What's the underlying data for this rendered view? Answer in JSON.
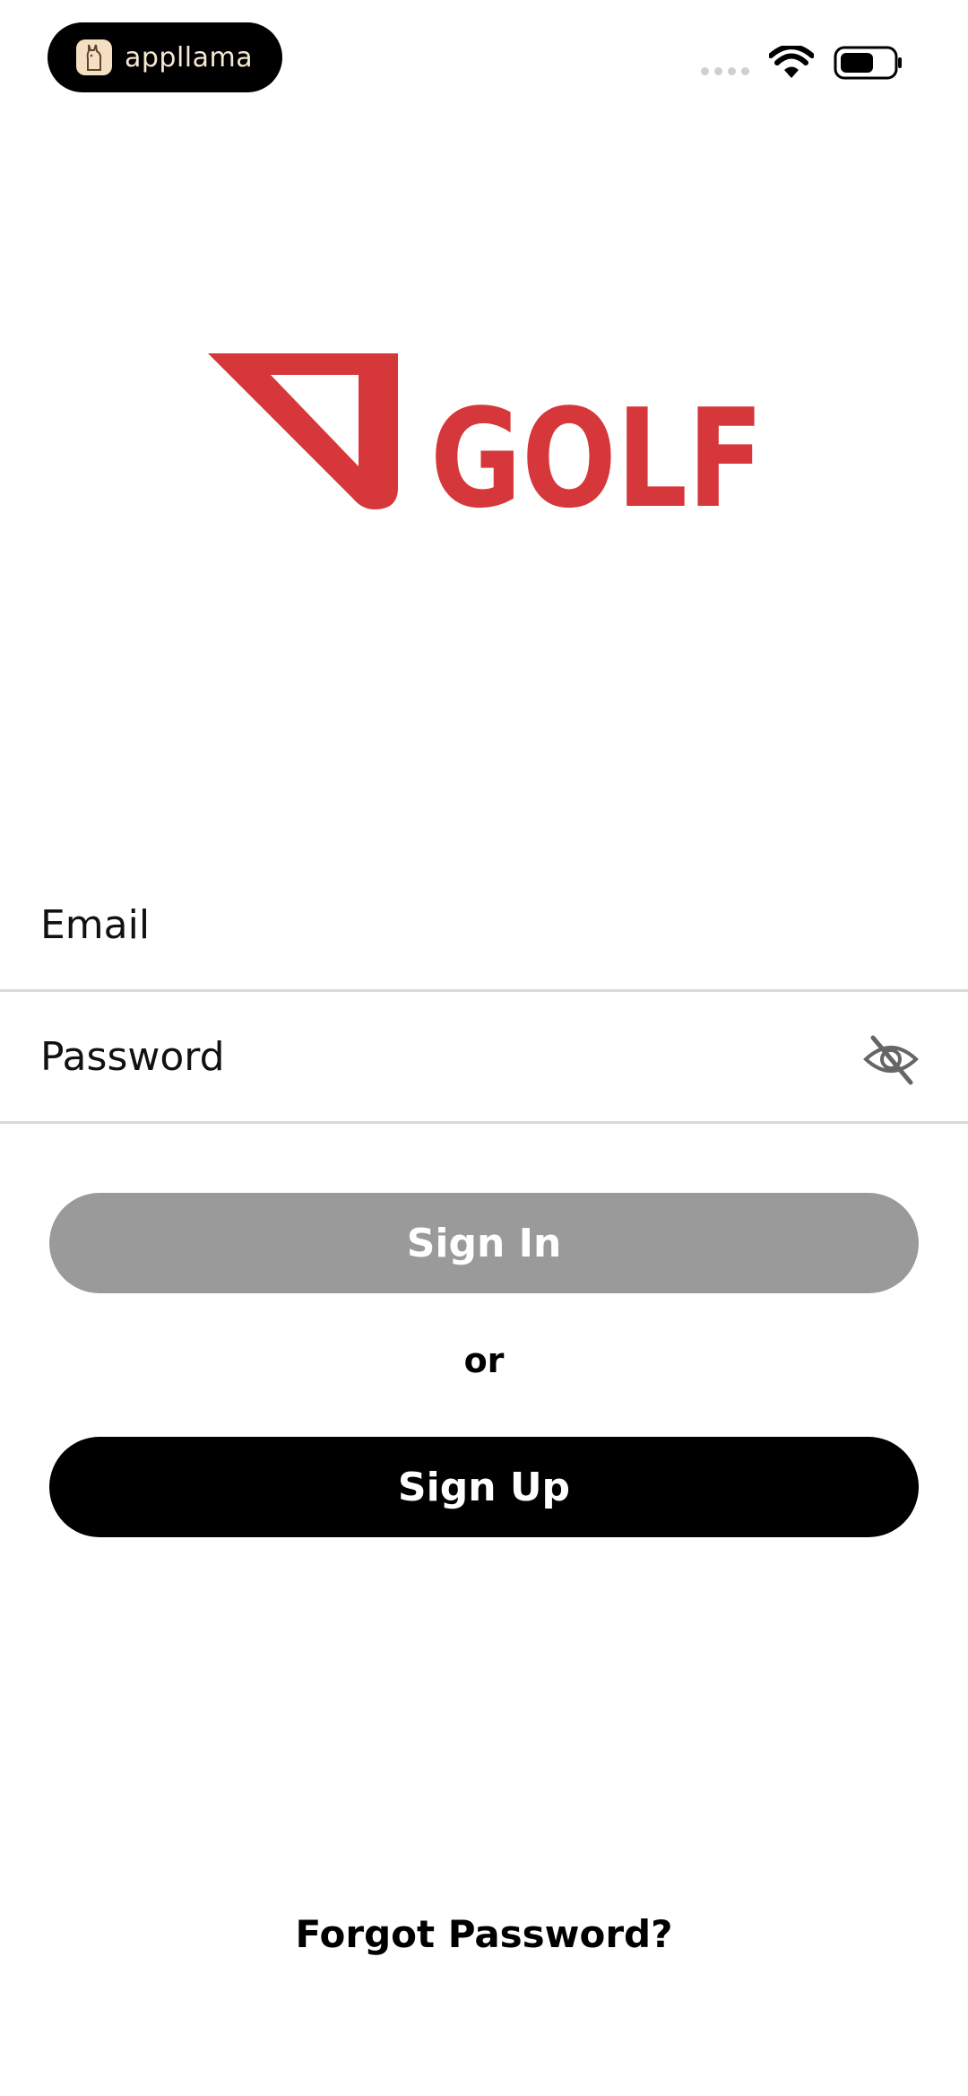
{
  "status_bar": {
    "app_name": "appllama",
    "icons": [
      "llama-icon",
      "signal-dots-icon",
      "wifi-icon",
      "battery-icon"
    ]
  },
  "logo": {
    "text": "GOLF",
    "brand_color": "#d6373a"
  },
  "form": {
    "email_placeholder": "Email",
    "password_placeholder": "Password",
    "password_toggle_icon": "eye-off-icon"
  },
  "buttons": {
    "sign_in": "Sign In",
    "or": "or",
    "sign_up": "Sign Up"
  },
  "links": {
    "forgot_password": "Forgot Password?"
  },
  "colors": {
    "sign_in_disabled": "#9a9a9a",
    "sign_up": "#000000",
    "divider": "#d9d9d9"
  }
}
